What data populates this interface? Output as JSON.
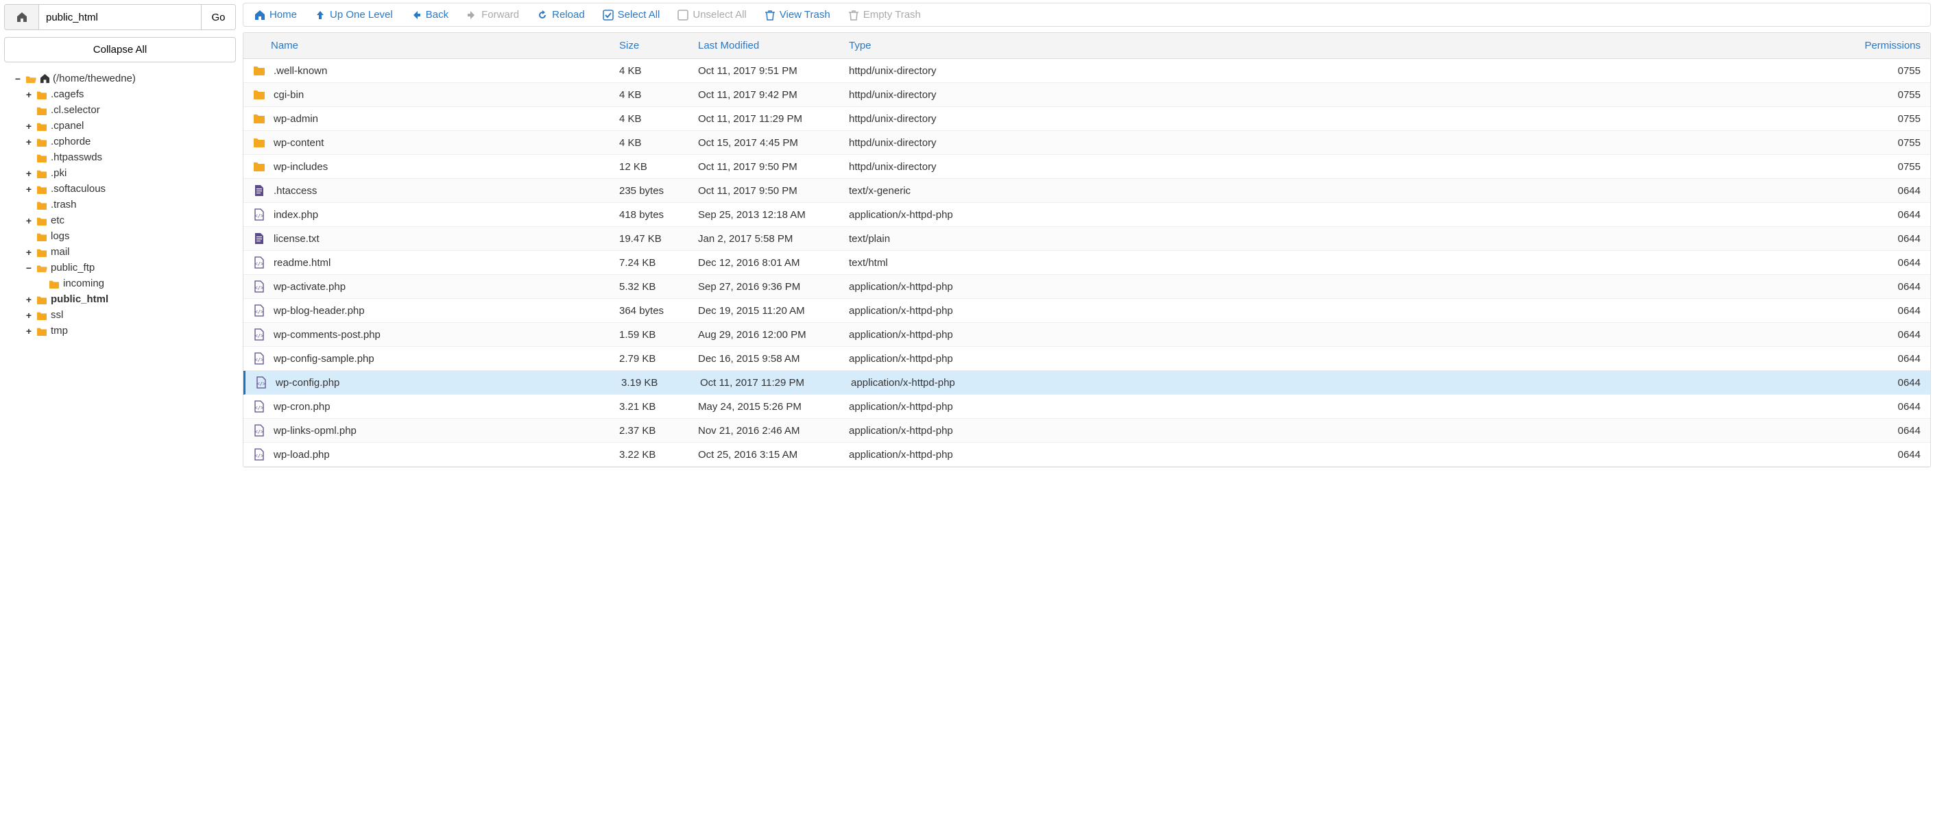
{
  "pathbar": {
    "value": "public_html",
    "go_label": "Go"
  },
  "collapse_all_label": "Collapse All",
  "tree": {
    "root_label": "(/home/thewedne)",
    "nodes": [
      {
        "label": ".cagefs",
        "toggle": "+",
        "depth": 1
      },
      {
        "label": ".cl.selector",
        "toggle": "",
        "depth": 1
      },
      {
        "label": ".cpanel",
        "toggle": "+",
        "depth": 1
      },
      {
        "label": ".cphorde",
        "toggle": "+",
        "depth": 1
      },
      {
        "label": ".htpasswds",
        "toggle": "",
        "depth": 1
      },
      {
        "label": ".pki",
        "toggle": "+",
        "depth": 1
      },
      {
        "label": ".softaculous",
        "toggle": "+",
        "depth": 1
      },
      {
        "label": ".trash",
        "toggle": "",
        "depth": 1
      },
      {
        "label": "etc",
        "toggle": "+",
        "depth": 1
      },
      {
        "label": "logs",
        "toggle": "",
        "depth": 1
      },
      {
        "label": "mail",
        "toggle": "+",
        "depth": 1
      },
      {
        "label": "public_ftp",
        "toggle": "−",
        "depth": 1
      },
      {
        "label": "incoming",
        "toggle": "",
        "depth": 2
      },
      {
        "label": "public_html",
        "toggle": "+",
        "depth": 1,
        "bold": true
      },
      {
        "label": "ssl",
        "toggle": "+",
        "depth": 1
      },
      {
        "label": "tmp",
        "toggle": "+",
        "depth": 1
      }
    ]
  },
  "toolbar": {
    "home": "Home",
    "up": "Up One Level",
    "back": "Back",
    "forward": "Forward",
    "reload": "Reload",
    "select_all": "Select All",
    "unselect_all": "Unselect All",
    "view_trash": "View Trash",
    "empty_trash": "Empty Trash"
  },
  "columns": {
    "name": "Name",
    "size": "Size",
    "modified": "Last Modified",
    "type": "Type",
    "permissions": "Permissions"
  },
  "rows": [
    {
      "icon": "folder",
      "name": ".well-known",
      "size": "4 KB",
      "mod": "Oct 11, 2017 9:51 PM",
      "type": "httpd/unix-directory",
      "perm": "0755",
      "selected": false
    },
    {
      "icon": "folder",
      "name": "cgi-bin",
      "size": "4 KB",
      "mod": "Oct 11, 2017 9:42 PM",
      "type": "httpd/unix-directory",
      "perm": "0755",
      "selected": false
    },
    {
      "icon": "folder",
      "name": "wp-admin",
      "size": "4 KB",
      "mod": "Oct 11, 2017 11:29 PM",
      "type": "httpd/unix-directory",
      "perm": "0755",
      "selected": false
    },
    {
      "icon": "folder",
      "name": "wp-content",
      "size": "4 KB",
      "mod": "Oct 15, 2017 4:45 PM",
      "type": "httpd/unix-directory",
      "perm": "0755",
      "selected": false
    },
    {
      "icon": "folder",
      "name": "wp-includes",
      "size": "12 KB",
      "mod": "Oct 11, 2017 9:50 PM",
      "type": "httpd/unix-directory",
      "perm": "0755",
      "selected": false
    },
    {
      "icon": "doc",
      "name": ".htaccess",
      "size": "235 bytes",
      "mod": "Oct 11, 2017 9:50 PM",
      "type": "text/x-generic",
      "perm": "0644",
      "selected": false
    },
    {
      "icon": "php",
      "name": "index.php",
      "size": "418 bytes",
      "mod": "Sep 25, 2013 12:18 AM",
      "type": "application/x-httpd-php",
      "perm": "0644",
      "selected": false
    },
    {
      "icon": "doc",
      "name": "license.txt",
      "size": "19.47 KB",
      "mod": "Jan 2, 2017 5:58 PM",
      "type": "text/plain",
      "perm": "0644",
      "selected": false
    },
    {
      "icon": "php",
      "name": "readme.html",
      "size": "7.24 KB",
      "mod": "Dec 12, 2016 8:01 AM",
      "type": "text/html",
      "perm": "0644",
      "selected": false
    },
    {
      "icon": "php",
      "name": "wp-activate.php",
      "size": "5.32 KB",
      "mod": "Sep 27, 2016 9:36 PM",
      "type": "application/x-httpd-php",
      "perm": "0644",
      "selected": false
    },
    {
      "icon": "php",
      "name": "wp-blog-header.php",
      "size": "364 bytes",
      "mod": "Dec 19, 2015 11:20 AM",
      "type": "application/x-httpd-php",
      "perm": "0644",
      "selected": false
    },
    {
      "icon": "php",
      "name": "wp-comments-post.php",
      "size": "1.59 KB",
      "mod": "Aug 29, 2016 12:00 PM",
      "type": "application/x-httpd-php",
      "perm": "0644",
      "selected": false
    },
    {
      "icon": "php",
      "name": "wp-config-sample.php",
      "size": "2.79 KB",
      "mod": "Dec 16, 2015 9:58 AM",
      "type": "application/x-httpd-php",
      "perm": "0644",
      "selected": false
    },
    {
      "icon": "php",
      "name": "wp-config.php",
      "size": "3.19 KB",
      "mod": "Oct 11, 2017 11:29 PM",
      "type": "application/x-httpd-php",
      "perm": "0644",
      "selected": true
    },
    {
      "icon": "php",
      "name": "wp-cron.php",
      "size": "3.21 KB",
      "mod": "May 24, 2015 5:26 PM",
      "type": "application/x-httpd-php",
      "perm": "0644",
      "selected": false
    },
    {
      "icon": "php",
      "name": "wp-links-opml.php",
      "size": "2.37 KB",
      "mod": "Nov 21, 2016 2:46 AM",
      "type": "application/x-httpd-php",
      "perm": "0644",
      "selected": false
    },
    {
      "icon": "php",
      "name": "wp-load.php",
      "size": "3.22 KB",
      "mod": "Oct 25, 2016 3:15 AM",
      "type": "application/x-httpd-php",
      "perm": "0644",
      "selected": false
    }
  ]
}
